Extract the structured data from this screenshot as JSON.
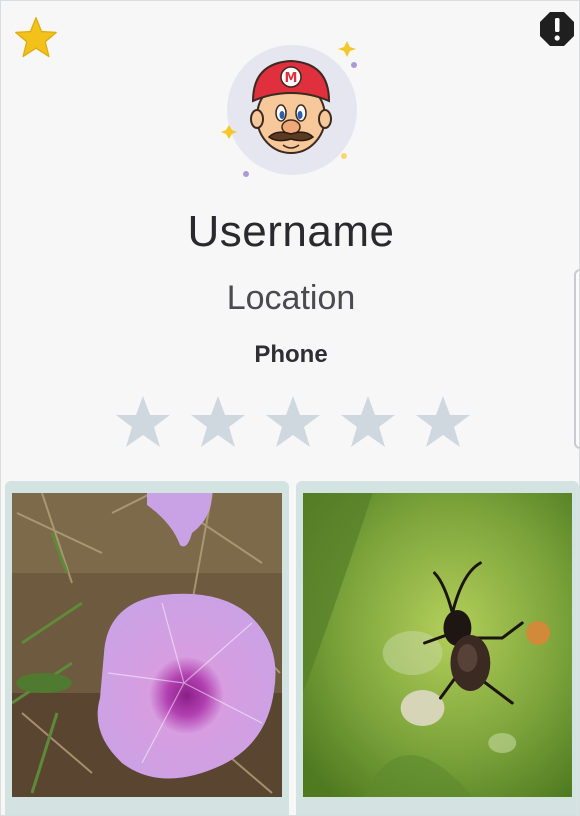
{
  "profile": {
    "username": "Username",
    "location": "Location",
    "phone": "Phone",
    "avatar_icon": "mario-avatar-icon",
    "rating": 0,
    "rating_max": 5
  },
  "actions": {
    "favorite_icon": "star-icon",
    "report_icon": "exclamation-octagon-icon"
  },
  "colors": {
    "favorite": "#f2c21b",
    "rating_empty": "#cfd8df",
    "tile_border": "#d3e3e1",
    "report": "#1f1f1f"
  },
  "gallery": [
    {
      "subject": "flower-photo"
    },
    {
      "subject": "beetle-photo"
    }
  ]
}
